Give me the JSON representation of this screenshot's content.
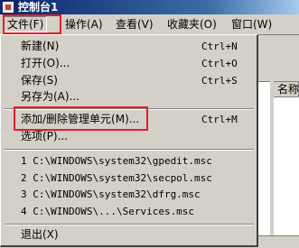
{
  "window": {
    "title": "控制台1"
  },
  "menubar": {
    "items": [
      {
        "label": "文件(F)"
      },
      {
        "label": "操作(A)"
      },
      {
        "label": "查看(V)"
      },
      {
        "label": "收藏夹(O)"
      },
      {
        "label": "窗口(W)"
      }
    ]
  },
  "file_menu": {
    "new": {
      "label": "新建(N)",
      "shortcut": "Ctrl+N"
    },
    "open": {
      "label": "打开(O)...",
      "shortcut": "Ctrl+O"
    },
    "save": {
      "label": "保存(S)",
      "shortcut": "Ctrl+S"
    },
    "save_as": {
      "label": "另存为(A)..."
    },
    "add_remove_snapin": {
      "label": "添加/删除管理单元(M)...",
      "shortcut": "Ctrl+M"
    },
    "options": {
      "label": "选项(P)..."
    },
    "recent": [
      "1 C:\\WINDOWS\\system32\\gpedit.msc",
      "2 C:\\WINDOWS\\system32\\secpol.msc",
      "3 C:\\WINDOWS\\system32\\dfrg.msc",
      "4 C:\\WINDOWS\\...\\Services.msc"
    ],
    "exit": {
      "label": "退出(X)"
    }
  },
  "background": {
    "column_header": "名称"
  },
  "colors": {
    "highlight_box": "#e0202a",
    "titlebar": "#0a246a"
  }
}
